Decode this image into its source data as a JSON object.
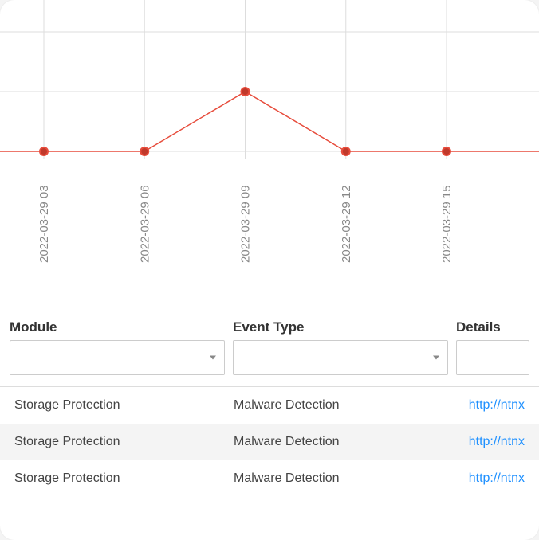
{
  "chart_data": {
    "type": "line",
    "categories": [
      "2022-03-29 03",
      "2022-03-29 06",
      "2022-03-29 09",
      "2022-03-29 12",
      "2022-03-29 15"
    ],
    "values": [
      0,
      0,
      1,
      0,
      0
    ],
    "ylim": [
      0,
      2
    ],
    "title": "",
    "xlabel": "",
    "ylabel": ""
  },
  "table": {
    "headers": {
      "module": "Module",
      "event_type": "Event Type",
      "details": "Details"
    },
    "filters": {
      "module": "",
      "event_type": "",
      "details": ""
    },
    "rows": [
      {
        "module": "Storage Protection",
        "event_type": "Malware Detection",
        "details": "http://ntnx"
      },
      {
        "module": "Storage Protection",
        "event_type": "Malware Detection",
        "details": "http://ntnx"
      },
      {
        "module": "Storage Protection",
        "event_type": "Malware Detection",
        "details": "http://ntnx"
      }
    ]
  }
}
